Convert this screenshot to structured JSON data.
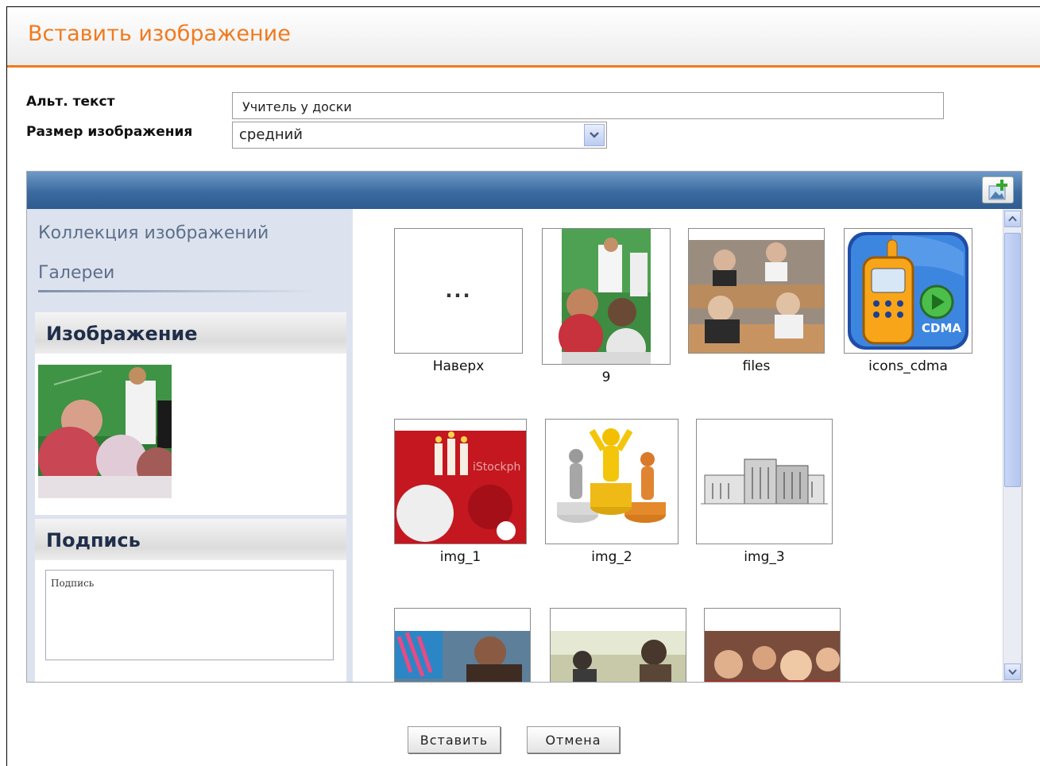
{
  "dialog": {
    "title": "Вставить изображение"
  },
  "form": {
    "alt_label": "Альт. текст",
    "alt_value": "Учитель у доски",
    "size_label": "Размер изображения",
    "size_value": "средний"
  },
  "sidebar": {
    "links": [
      "Коллекция изображений",
      "Галереи"
    ],
    "image_box_title": "Изображение",
    "caption_box_title": "Подпись",
    "caption_placeholder": "Подпись"
  },
  "gallery": {
    "up_glyph": "...",
    "items": [
      {
        "label": "Наверх"
      },
      {
        "label": "9"
      },
      {
        "label": "files"
      },
      {
        "label": "icons_cdma"
      },
      {
        "label": "img_1"
      },
      {
        "label": "img_2"
      },
      {
        "label": "img_3"
      }
    ],
    "cdma_text": "CDMA",
    "watermark_text": "iStockph"
  },
  "buttons": {
    "insert": "Вставить",
    "cancel": "Отмена"
  },
  "colors": {
    "accent": "#f07a1e",
    "toolbar": "#3a6aa0",
    "sidebar": "#dde3ee"
  }
}
